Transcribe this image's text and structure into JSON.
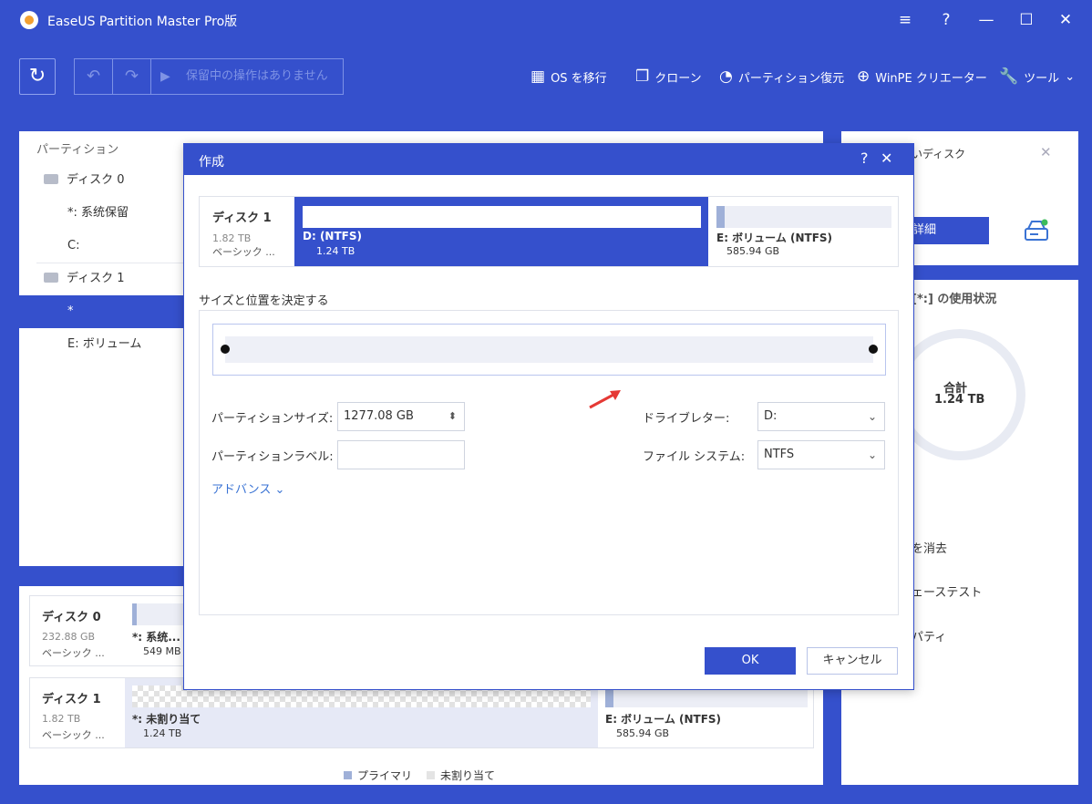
{
  "window": {
    "title": "EaseUS Partition Master Pro版",
    "menu_glyph": "≡",
    "help_glyph": "?",
    "min_glyph": "—",
    "max_glyph": "☐",
    "close_glyph": "✕"
  },
  "toolbar": {
    "refresh_glyph": "↻",
    "undo_glyph": "↶",
    "redo_glyph": "↷",
    "play_glyph": "▶",
    "pending_label": "保留中の操作はありません",
    "tools": [
      {
        "label": "OS を移行",
        "icon": "windows-icon",
        "glyph": "▦"
      },
      {
        "label": "クローン",
        "icon": "clone-icon",
        "glyph": "❐"
      },
      {
        "label": "パーティション復元",
        "icon": "pie-restore-icon",
        "glyph": "◔"
      },
      {
        "label": "WinPE クリエーター",
        "icon": "plus-circle-icon",
        "glyph": "⊕"
      },
      {
        "label": "ツール",
        "icon": "wrench-icon",
        "glyph": "🔧",
        "chevron": "⌄"
      }
    ]
  },
  "partition_list": {
    "header": "パーティション",
    "rows": [
      {
        "label": "ディスク 0",
        "type": "disk"
      },
      {
        "label": "*: 系统保留",
        "type": "partition"
      },
      {
        "label": "C:",
        "type": "partition"
      },
      {
        "label": "ディスク 1",
        "type": "disk"
      },
      {
        "label": "*",
        "type": "partition",
        "selected": true
      },
      {
        "label": "E: ボリューム",
        "type": "partition"
      }
    ]
  },
  "disk_map": {
    "disk0": {
      "name": "ディスク 0",
      "size": "232.88 GB",
      "type": "ベーシック ...",
      "part_label": "*: 系统...",
      "part_size": "549 MB"
    },
    "disk1": {
      "name": "ディスク 1",
      "size": "1.82 TB",
      "type": "ベーシック ...",
      "part1_label": "*: 未割り当て",
      "part1_size": "1.24 TB",
      "part2_label": "E: ボリューム (NTFS)",
      "part2_size": "585.94 GB"
    },
    "legend": [
      {
        "label": "プライマリ",
        "color": "#9fb0d8"
      },
      {
        "label": "未割り当て",
        "color": "#e4e4e4"
      }
    ]
  },
  "right_panel": {
    "disk_label": "いディスク",
    "close_glyph": "✕",
    "details_button": "詳細",
    "usage_title": "[*:] の使用状況",
    "total_label": "合計",
    "total_value": "1.24 TB",
    "actions": [
      "を消去",
      "ェーステスト",
      "パティ"
    ]
  },
  "dialog": {
    "title": "作成",
    "help_glyph": "?",
    "close_glyph": "✕",
    "disk": {
      "name": "ディスク 1",
      "size": "1.82 TB",
      "type": "ベーシック ..."
    },
    "partition_d": {
      "label": "D: (NTFS)",
      "size": "1.24 TB"
    },
    "partition_e": {
      "label": "E: ボリューム (NTFS)",
      "size": "585.94 GB"
    },
    "section_label": "サイズと位置を決定する",
    "fields": {
      "size_label": "パーティションサイズ:",
      "size_value": "1277.08 GB",
      "size_spin_glyph": "⬍",
      "label_label": "パーティションラベル:",
      "label_value": "",
      "drive_label": "ドライブレター:",
      "drive_value": "D:",
      "fs_label": "ファイル システム:",
      "fs_value": "NTFS",
      "select_chevron": "⌄"
    },
    "advanced": "アドバンス ⌄",
    "ok": "OK",
    "cancel": "キャンセル"
  }
}
